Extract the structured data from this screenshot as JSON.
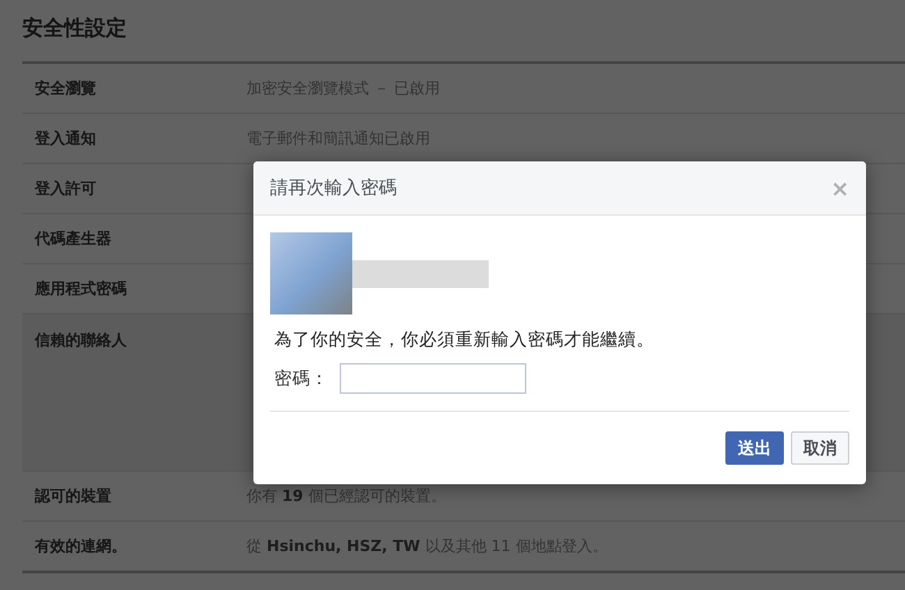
{
  "page": {
    "title": "安全性設定"
  },
  "settings": [
    {
      "label": "安全瀏覽",
      "value": "加密安全瀏覽模式 － 已啟用",
      "expanded": false
    },
    {
      "label": "登入通知",
      "value": "電子郵件和簡訊通知已啟用",
      "expanded": false
    },
    {
      "label": "登入許可",
      "expanded": false
    },
    {
      "label": "代碼產生器",
      "expanded": false
    },
    {
      "label": "應用程式密碼",
      "expanded": false
    },
    {
      "label": "信賴的聯絡人",
      "expanded": true
    },
    {
      "label": "認可的裝置",
      "value": "你有 **19** 個已經認可的裝置。",
      "expanded": false
    },
    {
      "label": "有效的連網。",
      "value": "從 **Hsinchu, HSZ, TW** 以及其他 11 個地點登入。",
      "expanded": false
    }
  ],
  "dialog": {
    "title": "請再次輸入密碼",
    "close": "×",
    "message": "為了你的安全，你必須重新輸入密碼才能繼續。",
    "field_label": "密碼：",
    "buttons": [
      {
        "label": "送出",
        "kind": "primary"
      },
      {
        "label": "取消",
        "kind": "secondary"
      }
    ]
  }
}
